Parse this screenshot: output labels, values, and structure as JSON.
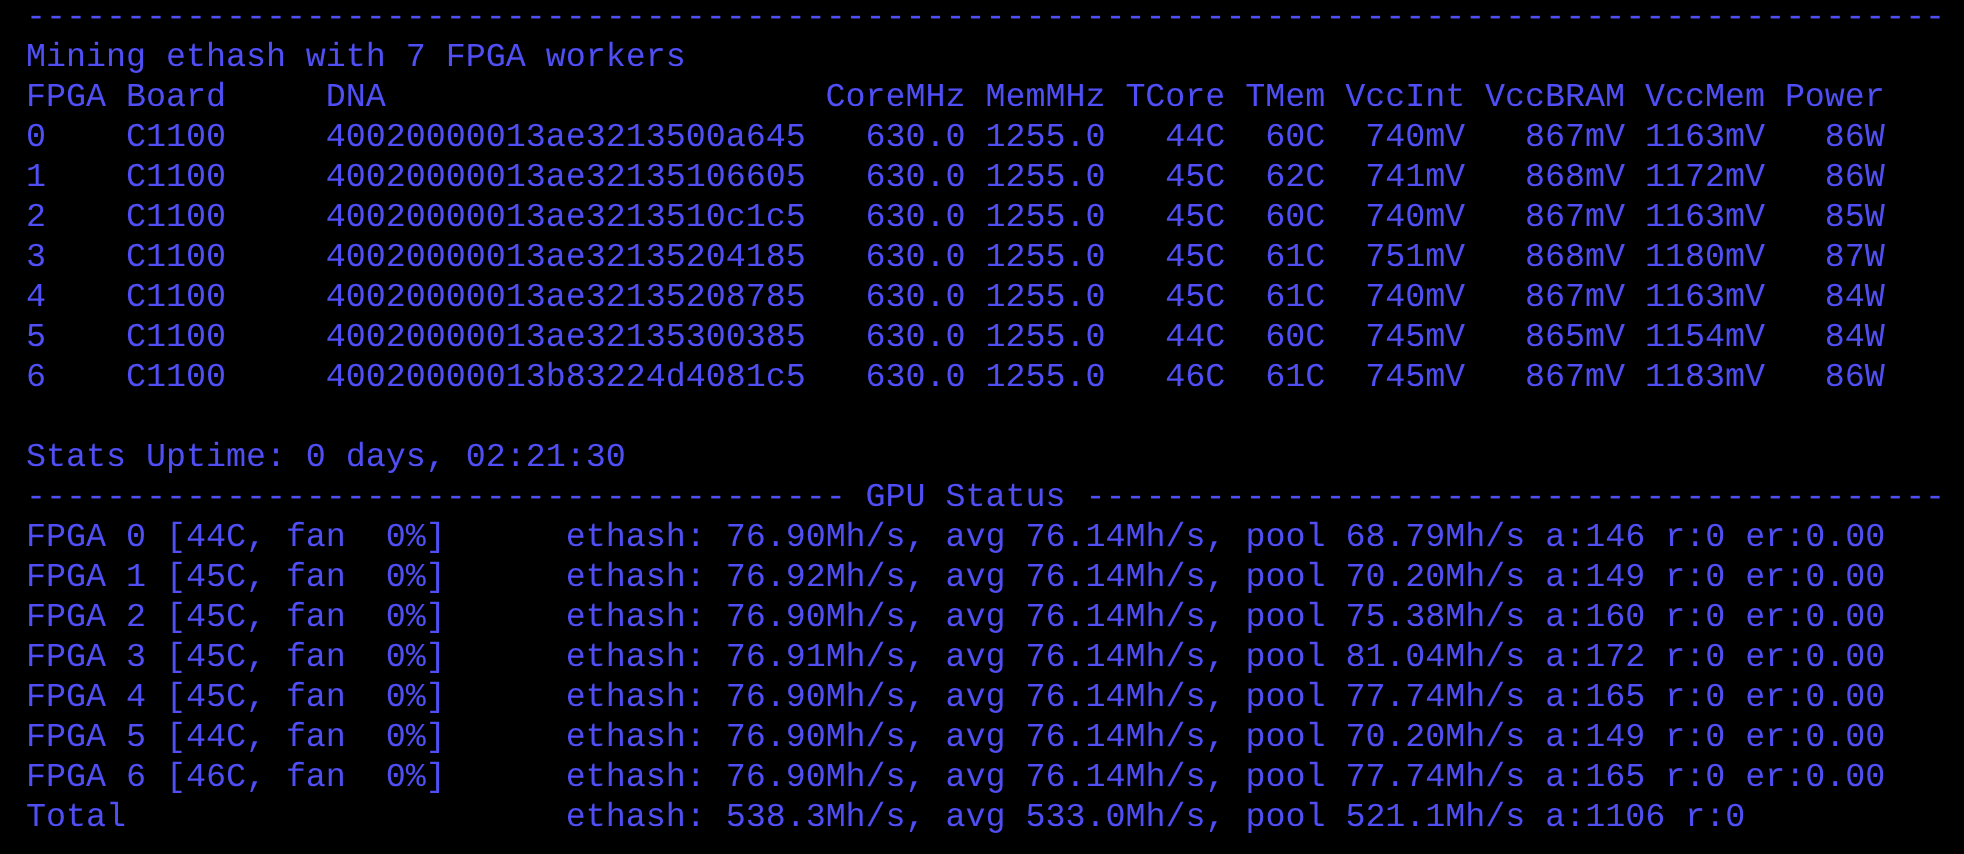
{
  "top_rule": "------------------------------------------------------------------------------------------------",
  "title": "Mining ethash with 7 FPGA workers",
  "board_table": {
    "columns": [
      "FPGA",
      "Board",
      "DNA",
      "CoreMHz",
      "MemMHz",
      "TCore",
      "TMem",
      "VccInt",
      "VccBRAM",
      "VccMem",
      "Power"
    ],
    "rows": [
      [
        "0",
        "C1100",
        "40020000013ae3213500a645",
        "630.0",
        "1255.0",
        "44C",
        "60C",
        "740mV",
        "867mV",
        "1163mV",
        "86W"
      ],
      [
        "1",
        "C1100",
        "40020000013ae32135106605",
        "630.0",
        "1255.0",
        "45C",
        "62C",
        "741mV",
        "868mV",
        "1172mV",
        "86W"
      ],
      [
        "2",
        "C1100",
        "40020000013ae3213510c1c5",
        "630.0",
        "1255.0",
        "45C",
        "60C",
        "740mV",
        "867mV",
        "1163mV",
        "85W"
      ],
      [
        "3",
        "C1100",
        "40020000013ae32135204185",
        "630.0",
        "1255.0",
        "45C",
        "61C",
        "751mV",
        "868mV",
        "1180mV",
        "87W"
      ],
      [
        "4",
        "C1100",
        "40020000013ae32135208785",
        "630.0",
        "1255.0",
        "45C",
        "61C",
        "740mV",
        "867mV",
        "1163mV",
        "84W"
      ],
      [
        "5",
        "C1100",
        "40020000013ae32135300385",
        "630.0",
        "1255.0",
        "44C",
        "60C",
        "745mV",
        "865mV",
        "1154mV",
        "84W"
      ],
      [
        "6",
        "C1100",
        "40020000013b83224d4081c5",
        "630.0",
        "1255.0",
        "46C",
        "61C",
        "745mV",
        "867mV",
        "1183mV",
        "86W"
      ]
    ]
  },
  "uptime": "Stats Uptime: 0 days, 02:21:30",
  "gpu_status_rule": "----------------------------------------- GPU Status -------------------------------------------",
  "gpu_status": [
    {
      "name": "FPGA 0 [44C, fan  0%]",
      "stats": "ethash: 76.90Mh/s, avg 76.14Mh/s, pool 68.79Mh/s a:146 r:0 er:0.00"
    },
    {
      "name": "FPGA 1 [45C, fan  0%]",
      "stats": "ethash: 76.92Mh/s, avg 76.14Mh/s, pool 70.20Mh/s a:149 r:0 er:0.00"
    },
    {
      "name": "FPGA 2 [45C, fan  0%]",
      "stats": "ethash: 76.90Mh/s, avg 76.14Mh/s, pool 75.38Mh/s a:160 r:0 er:0.00"
    },
    {
      "name": "FPGA 3 [45C, fan  0%]",
      "stats": "ethash: 76.91Mh/s, avg 76.14Mh/s, pool 81.04Mh/s a:172 r:0 er:0.00"
    },
    {
      "name": "FPGA 4 [45C, fan  0%]",
      "stats": "ethash: 76.90Mh/s, avg 76.14Mh/s, pool 77.74Mh/s a:165 r:0 er:0.00"
    },
    {
      "name": "FPGA 5 [44C, fan  0%]",
      "stats": "ethash: 76.90Mh/s, avg 76.14Mh/s, pool 70.20Mh/s a:149 r:0 er:0.00"
    },
    {
      "name": "FPGA 6 [46C, fan  0%]",
      "stats": "ethash: 76.90Mh/s, avg 76.14Mh/s, pool 77.74Mh/s a:165 r:0 er:0.00"
    },
    {
      "name": "Total",
      "stats": "ethash: 538.3Mh/s, avg 533.0Mh/s, pool 521.1Mh/s a:1106 r:0"
    }
  ]
}
